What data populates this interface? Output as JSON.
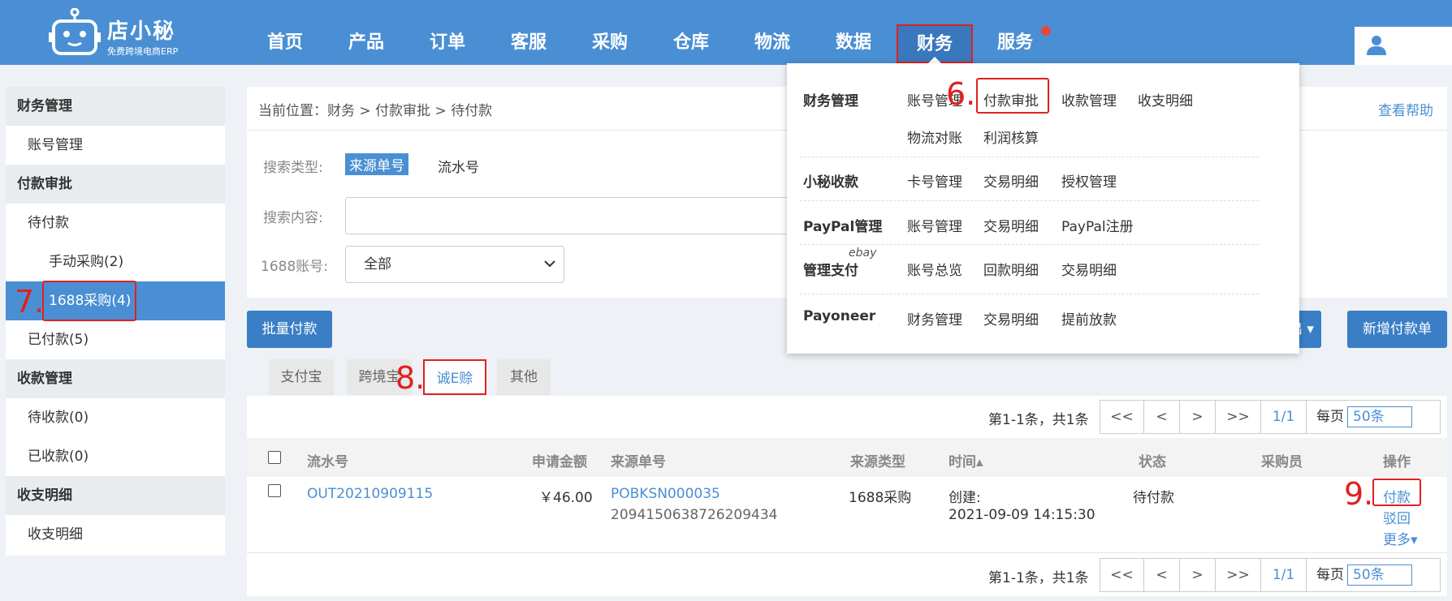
{
  "brand": {
    "name": "店小秘",
    "tagline": "免费跨境电商ERP"
  },
  "nav": [
    "首页",
    "产品",
    "订单",
    "客服",
    "采购",
    "仓库",
    "物流",
    "数据",
    "财务",
    "服务"
  ],
  "sidebar": {
    "finance_head": "财务管理",
    "account_mgmt": "账号管理",
    "pay_head": "付款审批",
    "pending": "待付款",
    "manual": "手动采购(2)",
    "p1688": "1688采购(4)",
    "paid": "已付款(5)",
    "recv_head": "收款管理",
    "pending_recv": "待收款(0)",
    "received": "已收款(0)",
    "flow_head": "收支明细",
    "flow_item": "收支明细"
  },
  "breadcrumb": "当前位置：财务 > 付款审批 > 待付款",
  "help": "查看帮助",
  "search": {
    "type_label": "搜索类型:",
    "type_active": "来源单号",
    "type_other": "流水号",
    "content_label": "搜索内容:",
    "account_label": "1688账号:",
    "account_value": "全部"
  },
  "buttons": {
    "batch": "批量付款",
    "export": "导出 ▾",
    "new": "新增付款单"
  },
  "tabs": [
    "支付宝",
    "跨境宝",
    "诚E赊",
    "其他"
  ],
  "pager": {
    "summary": "第1-1条，共1条",
    "first": "<<",
    "prev": "<",
    "next": ">",
    "last": ">>",
    "page": "1/1",
    "per_label": "每页",
    "per_value": "50条"
  },
  "table": {
    "headers": [
      "流水号",
      "申请金额",
      "来源单号",
      "来源类型",
      "时间▴",
      "状态",
      "采购员",
      "操作"
    ],
    "row": {
      "serial": "OUT20210909115",
      "amount": "￥46.00",
      "source_no": "POBKSN000035",
      "source_no2": "2094150638726209434",
      "source_type": "1688采购",
      "time_label": "创建:",
      "time_value": "2021-09-09 14:15:30",
      "status": "待付款",
      "action_pay": "付款",
      "action_reject": "驳回",
      "action_more": "更多▾"
    }
  },
  "dropdown": {
    "sections": [
      {
        "title": "财务管理",
        "links": [
          "账号管理",
          "付款审批",
          "收款管理",
          "收支明细",
          "物流对账",
          "利润核算"
        ]
      },
      {
        "title": "小秘收款",
        "links": [
          "卡号管理",
          "交易明细",
          "授权管理"
        ]
      },
      {
        "title": "PayPal管理",
        "links": [
          "账号管理",
          "交易明细",
          "PayPal注册"
        ]
      },
      {
        "title": "管理支付",
        "badge": "ebay",
        "links": [
          "账号总览",
          "回款明细",
          "交易明细"
        ]
      },
      {
        "title": "Payoneer",
        "links": [
          "财务管理",
          "交易明细",
          "提前放款"
        ]
      }
    ]
  },
  "step_labels": {
    "s6": "6.",
    "s7": "7.",
    "s8": "8.",
    "s9": "9."
  },
  "colors": {
    "primary": "#4a8fd3",
    "highlight": "#e02020",
    "dot": "#e8463a"
  }
}
